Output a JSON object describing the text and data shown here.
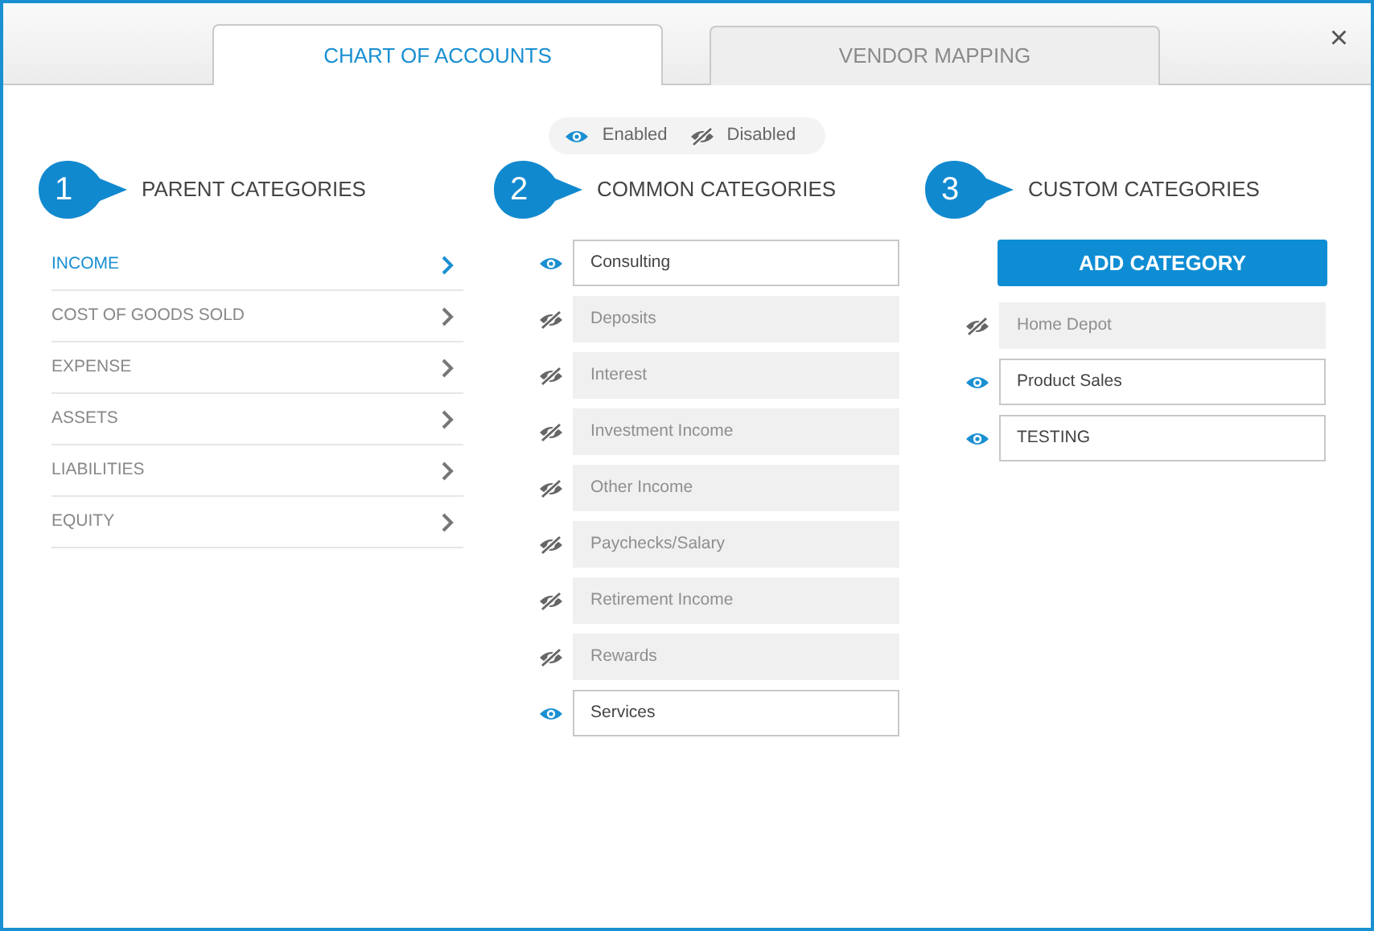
{
  "tabs": [
    {
      "label": "CHART OF ACCOUNTS",
      "selected": true
    },
    {
      "label": "VENDOR MAPPING",
      "selected": false
    }
  ],
  "close": "×",
  "legend": [
    {
      "label": "Enabled",
      "enabled": true
    },
    {
      "label": "Disabled",
      "enabled": false
    }
  ],
  "parent_categories": {
    "step": "1",
    "title": "PARENT CATEGORIES",
    "items": [
      {
        "label": "INCOME",
        "selected": true
      },
      {
        "label": "COST OF GOODS SOLD",
        "selected": false
      },
      {
        "label": "EXPENSE",
        "selected": false
      },
      {
        "label": "ASSETS",
        "selected": false
      },
      {
        "label": "LIABILITIES",
        "selected": false
      },
      {
        "label": "EQUITY",
        "selected": false
      }
    ]
  },
  "common_categories": {
    "step": "2",
    "title": "COMMON CATEGORIES",
    "items": [
      {
        "label": "Consulting",
        "enabled": true
      },
      {
        "label": "Deposits",
        "enabled": false
      },
      {
        "label": "Interest",
        "enabled": false
      },
      {
        "label": "Investment Income",
        "enabled": false
      },
      {
        "label": "Other Income",
        "enabled": false
      },
      {
        "label": "Paychecks/Salary",
        "enabled": false
      },
      {
        "label": "Retirement Income",
        "enabled": false
      },
      {
        "label": "Rewards",
        "enabled": false
      },
      {
        "label": "Services",
        "enabled": true
      }
    ]
  },
  "custom_categories": {
    "step": "3",
    "title": "CUSTOM CATEGORIES",
    "button": "ADD CATEGORY",
    "items": [
      {
        "label": "Home Depot",
        "enabled": false
      },
      {
        "label": "Product Sales",
        "enabled": true
      },
      {
        "label": "TESTING",
        "enabled": true
      }
    ]
  }
}
